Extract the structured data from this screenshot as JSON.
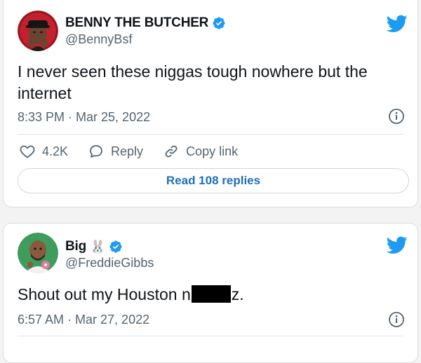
{
  "colors": {
    "brand_blue": "#1d9bf0",
    "link_blue": "#1d6fb8",
    "muted": "#536471"
  },
  "tweets": [
    {
      "author_name": "BENNY THE BUTCHER",
      "handle": "@BennyBsf",
      "verified": true,
      "text": "I never seen these niggas tough nowhere but the internet",
      "timestamp": "8:33 PM · Mar 25, 2022",
      "likes": "4.2K",
      "reply_label": "Reply",
      "copy_link_label": "Copy link",
      "read_replies_label": "Read 108 replies",
      "icons": [
        "avatar",
        "verified-badge-icon",
        "twitter-bird-icon",
        "info-icon",
        "heart-icon",
        "reply-bubble-icon",
        "link-icon"
      ]
    },
    {
      "author_name": "Big",
      "author_emoji": "🐰",
      "handle": "@FreddieGibbs",
      "verified": true,
      "text_before": "Shout out my Houston n",
      "text_after": "z.",
      "timestamp": "6:57 AM · Mar 27, 2022",
      "icons": [
        "avatar",
        "rabbit-emoji",
        "verified-badge-icon",
        "twitter-bird-icon",
        "info-icon"
      ]
    }
  ]
}
